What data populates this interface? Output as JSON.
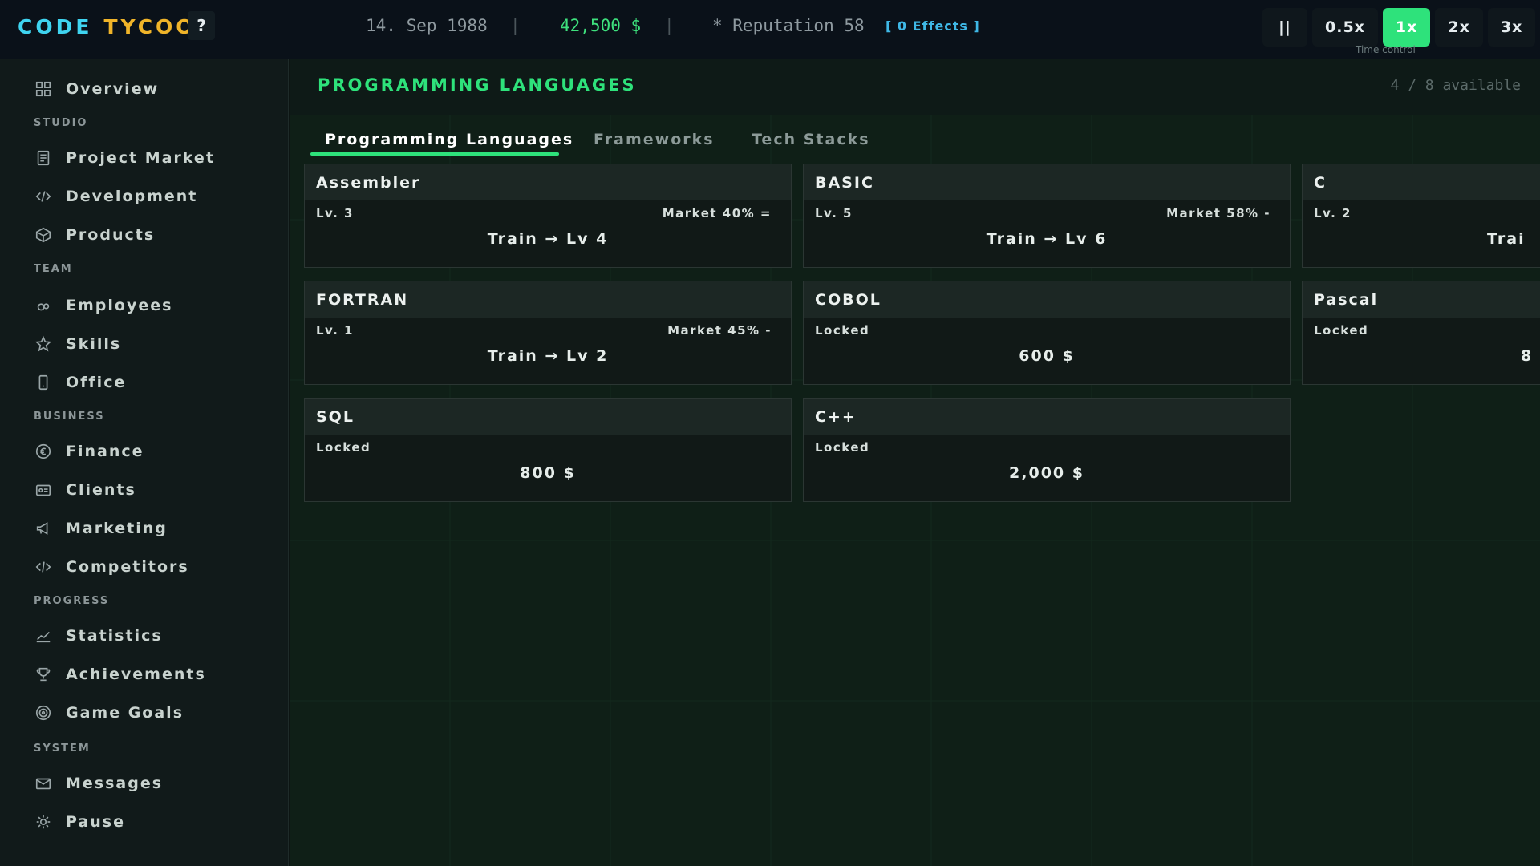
{
  "topbar": {
    "logo_word1": "CODE",
    "logo_word2": "TYCOON",
    "help_label": "?",
    "date": "14. Sep 1988",
    "separator": "|",
    "money": "42,500 $",
    "reputation": "* Reputation 58",
    "effects": "[ 0 Effects ]",
    "time_controls": {
      "pause": "||",
      "speeds": [
        "0.5x",
        "1x",
        "2x",
        "3x"
      ],
      "active": "1x",
      "label": "Time control"
    }
  },
  "sidebar": {
    "overview": "Overview",
    "sections": {
      "studio": "STUDIO",
      "team": "TEAM",
      "business": "BUSINESS",
      "progress": "PROGRESS",
      "system": "SYSTEM"
    },
    "items": {
      "project_market": "Project Market",
      "development": "Development",
      "products": "Products",
      "employees": "Employees",
      "skills": "Skills",
      "office": "Office",
      "finance": "Finance",
      "clients": "Clients",
      "marketing": "Marketing",
      "competitors": "Competitors",
      "statistics": "Statistics",
      "achievements": "Achievements",
      "game_goals": "Game Goals",
      "messages": "Messages",
      "pause": "Pause"
    }
  },
  "main": {
    "title": "PROGRAMMING LANGUAGES",
    "available": "4 / 8 available",
    "tabs": [
      "Programming Languages",
      "Frameworks",
      "Tech Stacks"
    ],
    "cards": [
      {
        "name": "Assembler",
        "level": "Lv. 3",
        "market": "Market 40% =",
        "action": "Train → Lv 4"
      },
      {
        "name": "BASIC",
        "level": "Lv. 5",
        "market": "Market 58% -",
        "action": "Train → Lv 6"
      },
      {
        "name": "C",
        "level": "Lv. 2",
        "market": "",
        "action": "Trai"
      },
      {
        "name": "FORTRAN",
        "level": "Lv. 1",
        "market": "Market 45% -",
        "action": "Train → Lv 2"
      },
      {
        "name": "COBOL",
        "level": "Locked",
        "market": "",
        "action": "600 $"
      },
      {
        "name": "Pascal",
        "level": "Locked",
        "market": "",
        "action": "8"
      },
      {
        "name": "SQL",
        "level": "Locked",
        "market": "",
        "action": "800 $"
      },
      {
        "name": "C++",
        "level": "Locked",
        "market": "",
        "action": "2,000 $"
      }
    ]
  }
}
